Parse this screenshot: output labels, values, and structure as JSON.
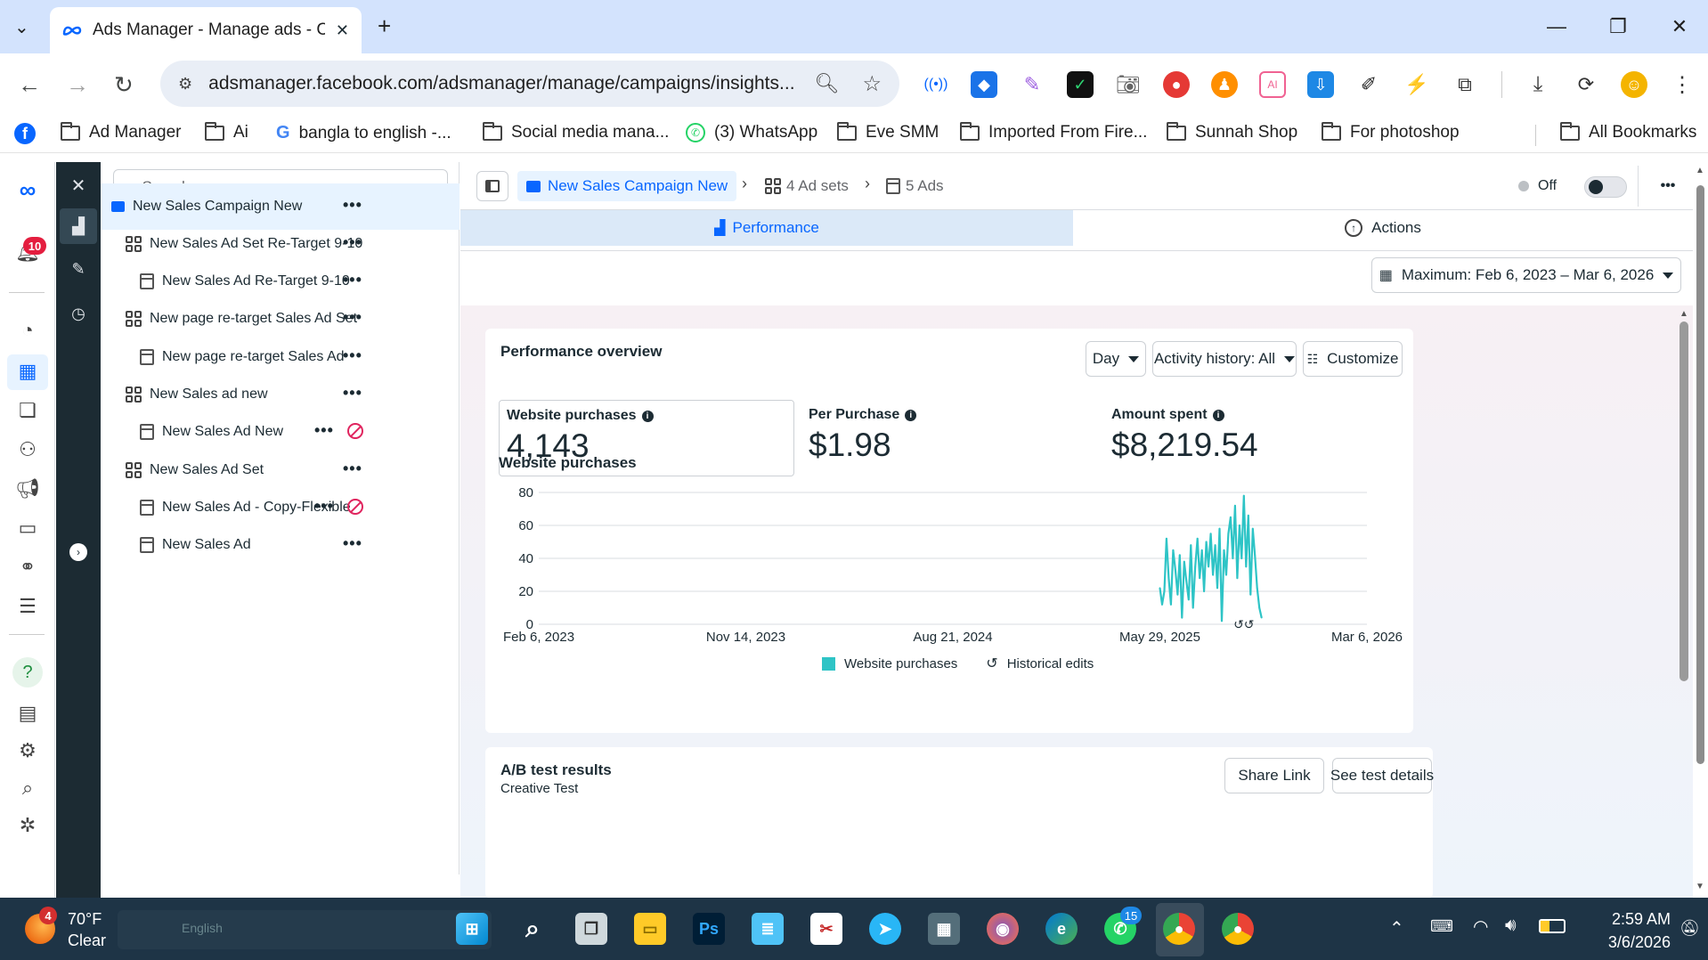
{
  "browser": {
    "tab_title": "Ads Manager - Manage ads - Campaigns",
    "url": "adsmanager.facebook.com/adsmanager/manage/campaigns/insights...",
    "bookmarks": [
      "Ad Manager",
      "Ai",
      "bangla to english -...",
      "Social media mana...",
      "(3) WhatsApp",
      "Eve SMM",
      "Imported From Fire...",
      "Sunnah Shop",
      "For photoshop"
    ],
    "all_bookmarks": "All Bookmarks"
  },
  "rail": {
    "notifications_badge": "10"
  },
  "tree": {
    "search_placeholder": "Search",
    "items": [
      {
        "label": "New Sales Campaign New",
        "level": "campaign",
        "disabled": false
      },
      {
        "label": "New Sales Ad Set Re-Target 9-10",
        "level": "adset",
        "disabled": false
      },
      {
        "label": "New Sales Ad Re-Target 9-10",
        "level": "ad",
        "disabled": false
      },
      {
        "label": "New page re-target Sales Ad Set",
        "level": "adset",
        "disabled": false
      },
      {
        "label": "New page re-target Sales Ad",
        "level": "ad",
        "disabled": false
      },
      {
        "label": "New Sales ad new",
        "level": "adset",
        "disabled": false
      },
      {
        "label": "New Sales Ad New",
        "level": "ad",
        "disabled": true
      },
      {
        "label": "New Sales Ad Set",
        "level": "adset",
        "disabled": false
      },
      {
        "label": "New Sales Ad - Copy-Flexible",
        "level": "ad",
        "disabled": true
      },
      {
        "label": "New Sales Ad",
        "level": "ad",
        "disabled": false
      }
    ]
  },
  "breadcrumb": {
    "campaign": "New Sales Campaign New",
    "adsets": "4 Ad sets",
    "ads": "5 Ads",
    "toggle_label": "Off"
  },
  "tabs": {
    "performance": "Performance",
    "actions": "Actions"
  },
  "date_range": "Maximum: Feb 6, 2023 – Mar 6, 2026",
  "overview": {
    "title": "Performance overview",
    "granularity": "Day",
    "activity": "Activity history: All",
    "customize": "Customize",
    "metrics": [
      {
        "label": "Website purchases",
        "value": "4,143"
      },
      {
        "label": "Per Purchase",
        "value": "$1.98"
      },
      {
        "label": "Amount spent",
        "value": "$8,219.54"
      }
    ]
  },
  "chart_data": {
    "type": "line",
    "title": "Website purchases",
    "ylim": [
      0,
      80
    ],
    "y_ticks": [
      "0",
      "20",
      "40",
      "60",
      "80"
    ],
    "x_ticks": [
      "Feb 6, 2023",
      "Nov 14, 2023",
      "Aug 21, 2024",
      "May 29, 2025",
      "Mar 6, 2026"
    ],
    "grid": true,
    "legend_placement": "bottom-center",
    "color": "#2ec4c6",
    "series": [
      {
        "name": "Website purchases",
        "x": [
          "2025-05-29",
          "2025-06-01",
          "2025-06-04",
          "2025-06-07",
          "2025-06-10",
          "2025-06-13",
          "2025-06-16",
          "2025-06-19",
          "2025-06-22",
          "2025-06-25",
          "2025-06-28",
          "2025-07-01",
          "2025-07-04",
          "2025-07-07",
          "2025-07-10",
          "2025-07-13",
          "2025-07-16",
          "2025-07-19",
          "2025-07-22",
          "2025-07-25",
          "2025-07-28",
          "2025-07-31",
          "2025-08-03",
          "2025-08-06",
          "2025-08-09",
          "2025-08-12",
          "2025-08-15",
          "2025-08-18",
          "2025-08-21",
          "2025-08-24",
          "2025-08-27",
          "2025-08-30",
          "2025-09-02",
          "2025-09-05",
          "2025-09-08",
          "2025-09-11",
          "2025-09-14",
          "2025-09-17",
          "2025-09-20",
          "2025-09-23",
          "2025-09-26",
          "2025-09-29",
          "2025-10-02",
          "2025-10-05",
          "2025-10-08",
          "2025-10-11",
          "2025-10-14"
        ],
        "values": [
          22,
          12,
          20,
          52,
          28,
          12,
          45,
          33,
          18,
          42,
          4,
          38,
          26,
          15,
          48,
          10,
          35,
          52,
          28,
          45,
          20,
          50,
          35,
          55,
          30,
          48,
          22,
          58,
          2,
          45,
          30,
          55,
          65,
          40,
          72,
          28,
          60,
          40,
          78,
          35,
          66,
          18,
          58,
          42,
          22,
          10,
          4
        ]
      }
    ],
    "annotations": [
      "Historical edits"
    ]
  },
  "legend": {
    "series": "Website purchases",
    "edits": "Historical edits"
  },
  "ab_test": {
    "title": "A/B test results",
    "subtitle": "Creative Test",
    "share": "Share Link",
    "details": "See test details"
  },
  "taskbar": {
    "weather_temp": "70°F",
    "weather_text": "Clear",
    "weather_badge": "4",
    "lang": "English",
    "time": "2:59 AM",
    "date": "3/6/2026",
    "whatsapp_badge": "15"
  }
}
